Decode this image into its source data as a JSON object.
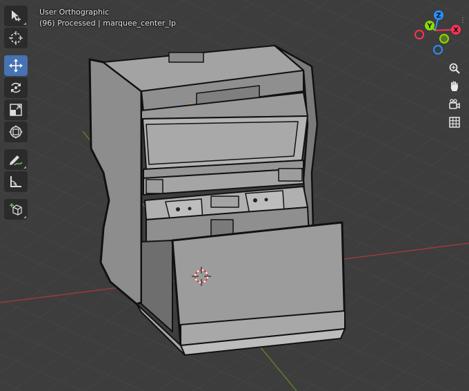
{
  "viewport": {
    "view_name": "User Orthographic",
    "status_text": "(96) Processed | marquee_center_lp",
    "axis_colors": {
      "x": "#ff3352",
      "y": "#8bdc00",
      "z": "#2890ff"
    }
  },
  "toolbar": {
    "tools": [
      {
        "name": "select-tool",
        "icon": "select-cursor-icon",
        "active": false
      },
      {
        "name": "cursor-tool",
        "icon": "3d-cursor-icon",
        "active": false
      },
      {
        "name": "move-tool",
        "icon": "move-arrows-icon",
        "active": true
      },
      {
        "name": "rotate-tool",
        "icon": "rotate-icon",
        "active": false
      },
      {
        "name": "scale-tool",
        "icon": "scale-icon",
        "active": false
      },
      {
        "name": "transform-tool",
        "icon": "transform-icon",
        "active": false
      },
      {
        "name": "annotate-tool",
        "icon": "annotate-pen-icon",
        "active": false
      },
      {
        "name": "measure-tool",
        "icon": "measure-ruler-icon",
        "active": false
      },
      {
        "name": "add-cube-tool",
        "icon": "add-cube-icon",
        "active": false
      }
    ]
  },
  "gizmo": {
    "x_label": "X",
    "y_label": "Y",
    "z_label": "Z"
  },
  "nav_buttons": [
    "zoom-icon",
    "hand-pan-icon",
    "camera-icon",
    "grid-icon"
  ]
}
